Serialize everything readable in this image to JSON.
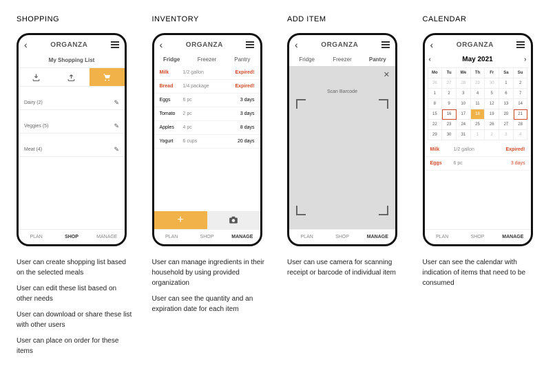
{
  "app_title": "ORGANZA",
  "nav": {
    "plan": "PLAN",
    "shop": "SHOP",
    "manage": "MANAGE"
  },
  "shopping": {
    "heading": "SHOPPING",
    "subtitle": "My Shopping List",
    "categories": [
      {
        "label": "Dairy (2)"
      },
      {
        "label": "Veggies (5)"
      },
      {
        "label": "Meat (4)"
      }
    ],
    "desc": [
      "User can create shopping list based on the selected meals",
      "User can edit these list based on other needs",
      "User can download or share these list with other users",
      "User can place on order for these items"
    ]
  },
  "inventory": {
    "heading": "INVENTORY",
    "tabs": {
      "fridge": "Fridge",
      "freezer": "Freezer",
      "pantry": "Pantry"
    },
    "rows": [
      {
        "name": "Milk",
        "qty": "1/2 gallon",
        "exp": "Expired!",
        "expired": true
      },
      {
        "name": "Bread",
        "qty": "1/4 package",
        "exp": "Expired!",
        "expired": true
      },
      {
        "name": "Eggs",
        "qty": "6 pc",
        "exp": "3 days"
      },
      {
        "name": "Tomato",
        "qty": "2 pc",
        "exp": "3 days"
      },
      {
        "name": "Apples",
        "qty": "4 pc",
        "exp": "8 days"
      },
      {
        "name": "Yogurt",
        "qty": "6 cups",
        "exp": "20 days"
      }
    ],
    "desc": [
      "User can manage ingredients in their household by using provided organization",
      "User can see the quantity and an expiration date for each item"
    ]
  },
  "additem": {
    "heading": "ADD ITEM",
    "scan_label": "Scan Barcode",
    "active_tab": "Pantry",
    "desc": [
      "User can use camera for scanning receipt or barcode of individual item"
    ]
  },
  "calendar": {
    "heading": "CALENDAR",
    "month": "May 2021",
    "dow": [
      "Mo",
      "Tu",
      "We",
      "Th",
      "Fr",
      "Sa",
      "Su"
    ],
    "weeks": [
      [
        {
          "d": "26",
          "dim": true
        },
        {
          "d": "27",
          "dim": true
        },
        {
          "d": "28",
          "dim": true
        },
        {
          "d": "29",
          "dim": true
        },
        {
          "d": "30",
          "dim": true
        },
        {
          "d": "1"
        },
        {
          "d": "2"
        }
      ],
      [
        {
          "d": "1"
        },
        {
          "d": "2"
        },
        {
          "d": "3"
        },
        {
          "d": "4"
        },
        {
          "d": "5"
        },
        {
          "d": "6"
        },
        {
          "d": "7"
        }
      ],
      [
        {
          "d": "8"
        },
        {
          "d": "9"
        },
        {
          "d": "10"
        },
        {
          "d": "11"
        },
        {
          "d": "12"
        },
        {
          "d": "13"
        },
        {
          "d": "14"
        }
      ],
      [
        {
          "d": "15"
        },
        {
          "d": "16",
          "marked": true
        },
        {
          "d": "17"
        },
        {
          "d": "18",
          "today": true
        },
        {
          "d": "19"
        },
        {
          "d": "20"
        },
        {
          "d": "21",
          "marked": true
        }
      ],
      [
        {
          "d": "22"
        },
        {
          "d": "23"
        },
        {
          "d": "24"
        },
        {
          "d": "25"
        },
        {
          "d": "26"
        },
        {
          "d": "27"
        },
        {
          "d": "28"
        }
      ],
      [
        {
          "d": "29"
        },
        {
          "d": "30"
        },
        {
          "d": "31"
        },
        {
          "d": "1",
          "dim": true
        },
        {
          "d": "2",
          "dim": true
        },
        {
          "d": "3",
          "dim": true
        },
        {
          "d": "4",
          "dim": true
        }
      ]
    ],
    "list": [
      {
        "name": "Milk",
        "qty": "1/2 gallon",
        "exp": "Expired!"
      },
      {
        "name": "Eggs",
        "qty": "6 pc",
        "exp": "3 days"
      }
    ],
    "desc": [
      "User can see the calendar with indication of items that need to be consumed"
    ]
  }
}
